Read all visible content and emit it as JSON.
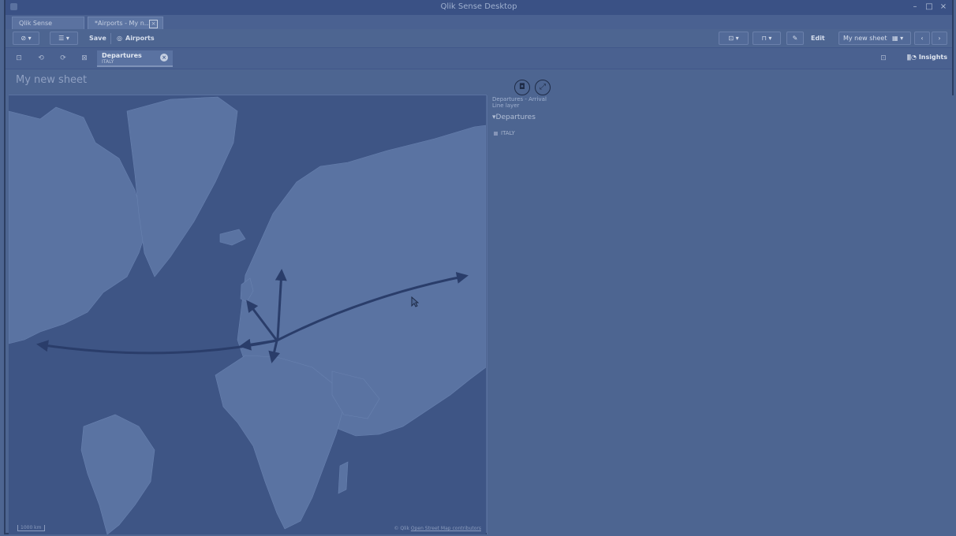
{
  "window": {
    "title": "Qlik Sense Desktop",
    "controls": [
      "–",
      "□",
      "×"
    ]
  },
  "tabs": [
    {
      "label": "Qlik Sense Desktop hub"
    },
    {
      "label": "*Airports - My n..."
    }
  ],
  "toolbar": {
    "save_label": "Save",
    "app_label": "Airports",
    "edit_label": "Edit",
    "sheet_label": "My new sheet"
  },
  "selections": {
    "chip_field": "Departures",
    "chip_value": "ITALY",
    "insights_label": "Insights"
  },
  "sheet": {
    "title": "My new sheet"
  },
  "map": {
    "scale_label": "1000 km",
    "attribution_prefix": "© Qlik",
    "attribution_link": "Open Street Map contributors"
  },
  "legend": {
    "layer_title": "Departures - Arrival Line layer",
    "group_label": "Departures",
    "item_label": "ITALY"
  },
  "colors": {
    "background": "#4d6591",
    "map_land": "#5f7aa8",
    "map_water": "#3e5585",
    "arrow": "#2a3d6a"
  }
}
